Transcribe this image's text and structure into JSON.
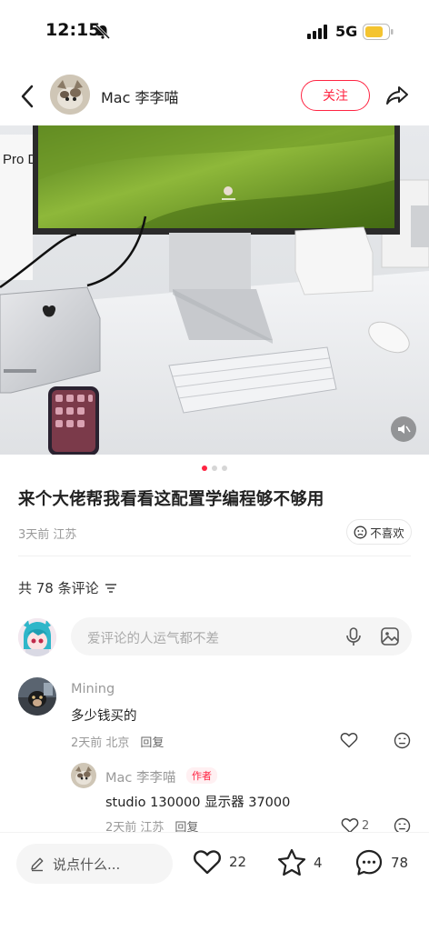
{
  "status_bar": {
    "time": "12:15",
    "network": "5G"
  },
  "header": {
    "author_name": "Mac 李李喵",
    "follow_label": "关注"
  },
  "photo": {
    "screen_text": "Pro D",
    "page_count": 3,
    "current_page": 1
  },
  "post": {
    "title": "来个大佬帮我看看这配置学编程够不够用",
    "meta": "3天前 江苏",
    "dislike_label": "不喜欢"
  },
  "comments_section": {
    "count_label": "共 78 条评论",
    "input_placeholder": "爱评论的人运气都不差"
  },
  "comments": [
    {
      "user": "Mining",
      "text": "多少钱买的",
      "meta": "2天前 北京",
      "reply_label": "回复"
    }
  ],
  "replies": [
    {
      "user": "Mac 李李喵",
      "badge": "作者",
      "text": "studio 130000 显示器 37000",
      "meta": "2天前 江苏",
      "reply_label": "回复",
      "likes": "2"
    }
  ],
  "bottom_bar": {
    "input_placeholder": "说点什么...",
    "likes": "22",
    "collects": "4",
    "comments": "78"
  },
  "colors": {
    "accent": "#ff2442",
    "muted_text": "#999999",
    "input_bg": "#f5f5f5"
  }
}
